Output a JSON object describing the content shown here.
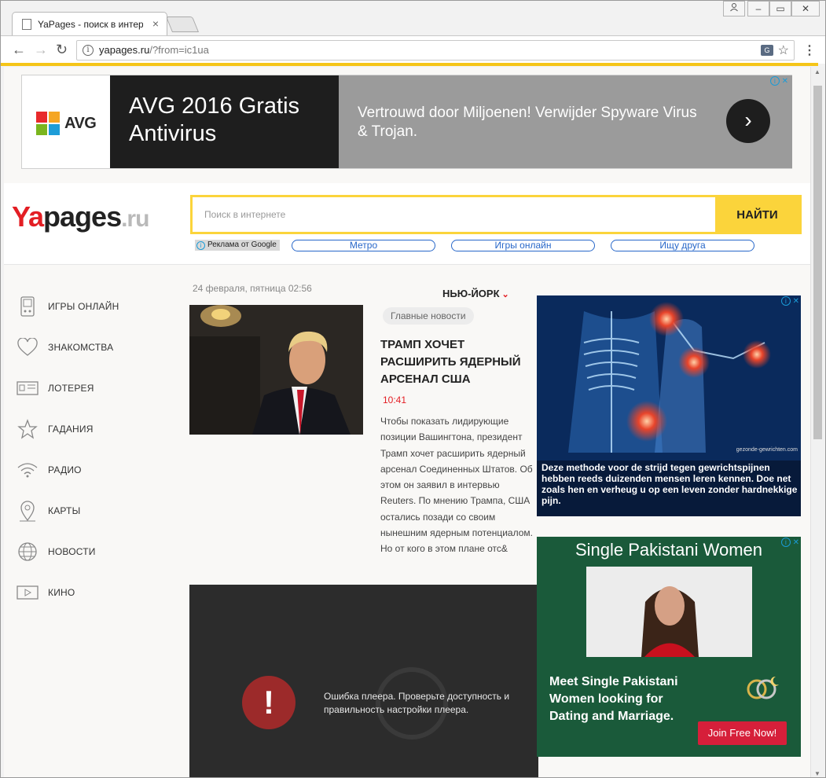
{
  "browser": {
    "tab_title": "YaPages - поиск в интер",
    "tab_close": "×",
    "url_host": "yapages.ru",
    "url_path": "/?from=ic1ua",
    "translate_icon": "translate-icon",
    "bookmark_icon": "star-icon"
  },
  "top_ad": {
    "brand": "AVG",
    "headline": "AVG 2016 Gratis Antivirus",
    "description": "Vertrouwd door Miljoenen! Verwijder Spyware Virus & Trojan.",
    "cta_icon": "chevron-right-icon"
  },
  "header": {
    "logo_ya": "Ya",
    "logo_pages": "pages",
    "logo_ru": ".ru",
    "search_placeholder": "Поиск в интернете",
    "search_button": "НАЙТИ",
    "google_ad_label": "Реклама от Google",
    "quick_links": [
      "Метро",
      "Игры онлайн",
      "Ищу друга"
    ]
  },
  "sidebar": {
    "items": [
      {
        "label": "ИГРЫ ОНЛАЙН",
        "icon": "gamepad-icon"
      },
      {
        "label": "ЗНАКОМСТВА",
        "icon": "heart-icon"
      },
      {
        "label": "ЛОТЕРЕЯ",
        "icon": "ticket-icon"
      },
      {
        "label": "ГАДАНИЯ",
        "icon": "star-icon"
      },
      {
        "label": "РАДИО",
        "icon": "wifi-icon"
      },
      {
        "label": "КАРТЫ",
        "icon": "map-pin-icon"
      },
      {
        "label": "НОВОСТИ",
        "icon": "globe-icon"
      },
      {
        "label": "КИНО",
        "icon": "play-icon"
      }
    ]
  },
  "main": {
    "date": "24 февраля, пятница 02:56",
    "city": "НЬЮ-ЙОРК",
    "news_tag": "Главные новости",
    "headline": "ТРАМП ХОЧЕТ РАСШИРИТЬ ЯДЕРНЫЙ АРСЕНАЛ США",
    "time": "10:41",
    "body": "Чтобы показать лидирующие позиции Вашингтона, президент Трамп хочет расширить ядерный арсенал Соединенных Штатов. Об этом он заявил в интервью Reuters. По мнению Трампа, США остались позади со своим нынешним ядерным потенциалом. Но от кого в этом плане отс&",
    "player_error_icon": "!",
    "player_error": "Ошибка плеера. Проверьте доступность и правильность настройки плеера."
  },
  "ads": {
    "medical_caption": "Deze methode voor de strijd tegen gewrichtspijnen hebben reeds duizenden mensen leren kennen. Doe net zoals hen en verheug u op een leven zonder hardnekkige pijn.",
    "medical_source": "gezonde-gewrichten.com",
    "dating_title": "Single Pakistani Women",
    "dating_text": "Meet Single Pakistani Women looking for Dating and Marriage.",
    "dating_button": "Join Free Now!"
  },
  "colors": {
    "accent_yellow": "#fbd43b",
    "brand_red": "#e31e24",
    "link_blue": "#2767c9"
  }
}
